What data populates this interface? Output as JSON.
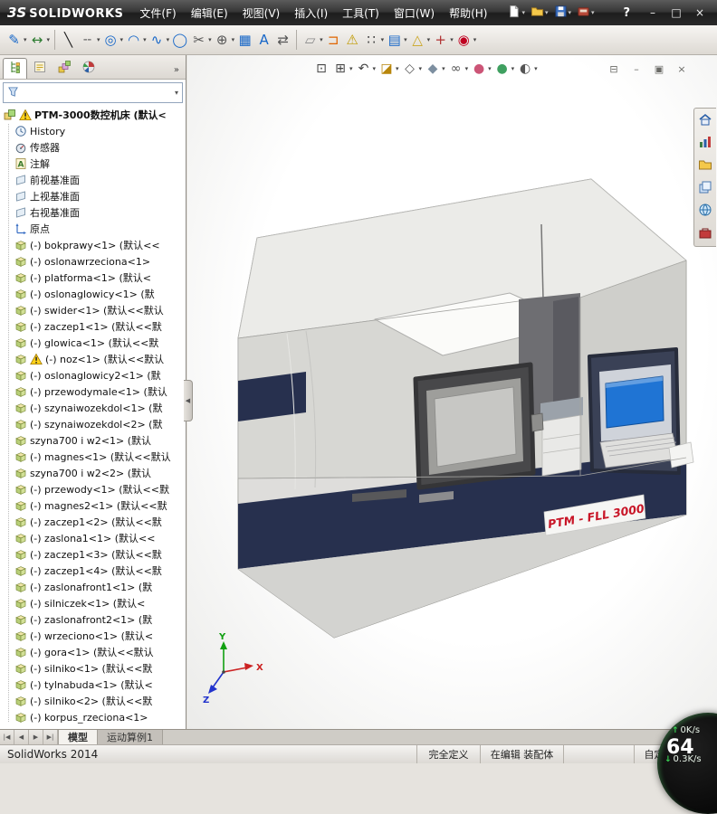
{
  "titlebar": {
    "logo_mark": "3S",
    "logo_text": "SOLIDWORKS",
    "menus": [
      "文件(F)",
      "编辑(E)",
      "视图(V)",
      "插入(I)",
      "工具(T)",
      "窗口(W)",
      "帮助(H)"
    ],
    "quick_icons": [
      "new-doc-icon",
      "open-icon",
      "save-icon",
      "print-icon"
    ],
    "help_button": "?",
    "minimize": "–",
    "maximize": "□",
    "close": "×"
  },
  "sketch_toolbar": {
    "icons": [
      {
        "name": "sketch-icon",
        "caret": true
      },
      {
        "name": "smart-dimension-icon",
        "caret": true
      },
      {
        "name": "sep"
      },
      {
        "name": "line-icon",
        "caret": false
      },
      {
        "name": "centerline-icon",
        "caret": true
      },
      {
        "name": "circle-icon",
        "caret": true
      },
      {
        "name": "arc-icon",
        "caret": true
      },
      {
        "name": "spline-icon",
        "caret": true
      },
      {
        "name": "ellipse-icon",
        "caret": false
      },
      {
        "name": "trim-icon",
        "caret": true
      },
      {
        "name": "point-icon",
        "caret": true
      },
      {
        "name": "hatch-icon",
        "caret": false
      },
      {
        "name": "text-icon",
        "caret": false
      },
      {
        "name": "mirror-icon",
        "caret": false
      },
      {
        "name": "sep"
      },
      {
        "name": "plane-tool-icon",
        "caret": true
      },
      {
        "name": "convert-icon",
        "caret": false
      },
      {
        "name": "relations-icon",
        "caret": false
      },
      {
        "name": "pattern-icon",
        "caret": true
      },
      {
        "name": "grid-icon",
        "caret": true
      },
      {
        "name": "evaluate-icon",
        "caret": true
      },
      {
        "name": "snap-icon",
        "caret": true
      },
      {
        "name": "record-icon",
        "caret": true
      }
    ]
  },
  "panel": {
    "tabs": [
      "featuremanager-tab",
      "propertymanager-tab",
      "configurationmanager-tab",
      "displaymanager-tab"
    ],
    "tabs_overflow": "»",
    "filter": {
      "value": "",
      "placeholder": ""
    },
    "tree": [
      {
        "icon": "assembly-icon",
        "warn": true,
        "top": true,
        "label": "PTM-3000数控机床 (默认<"
      },
      {
        "icon": "history-icon",
        "label": "History"
      },
      {
        "icon": "sensor-icon",
        "label": "传感器"
      },
      {
        "icon": "annotations-icon",
        "label": "注解"
      },
      {
        "icon": "plane-icon",
        "label": "前视基准面"
      },
      {
        "icon": "plane-icon",
        "label": "上视基准面"
      },
      {
        "icon": "plane-icon",
        "label": "右视基准面"
      },
      {
        "icon": "origin-icon",
        "label": "原点"
      },
      {
        "icon": "part-icon",
        "label": "(-) bokprawy<1> (默认<<"
      },
      {
        "icon": "part-icon",
        "label": "(-) oslonawrzeciona<1>"
      },
      {
        "icon": "part-icon",
        "label": "(-) platforma<1> (默认<"
      },
      {
        "icon": "part-icon",
        "label": "(-) oslonaglowicy<1> (默"
      },
      {
        "icon": "part-icon",
        "label": "(-) swider<1> (默认<<默认"
      },
      {
        "icon": "part-icon",
        "label": "(-) zaczep1<1> (默认<<默"
      },
      {
        "icon": "part-icon",
        "label": "(-) glowica<1> (默认<<默"
      },
      {
        "icon": "part-icon",
        "warn": true,
        "label": "(-) noz<1> (默认<<默认"
      },
      {
        "icon": "part-icon",
        "label": "(-) oslonaglowicy2<1> (默"
      },
      {
        "icon": "part-icon",
        "label": "(-) przewodymale<1> (默认"
      },
      {
        "icon": "part-icon",
        "label": "(-) szynaiwozekdol<1> (默"
      },
      {
        "icon": "part-icon",
        "label": "(-) szynaiwozekdol<2> (默"
      },
      {
        "icon": "part-icon",
        "label": "szyna700 i w2<1> (默认"
      },
      {
        "icon": "part-icon",
        "label": "(-) magnes<1> (默认<<默认"
      },
      {
        "icon": "part-icon",
        "label": "szyna700 i w2<2> (默认"
      },
      {
        "icon": "part-icon",
        "label": "(-) przewody<1> (默认<<默"
      },
      {
        "icon": "part-icon",
        "label": "(-) magnes2<1> (默认<<默"
      },
      {
        "icon": "part-icon",
        "label": "(-) zaczep1<2> (默认<<默"
      },
      {
        "icon": "part-icon",
        "label": "(-) zaslona1<1> (默认<<"
      },
      {
        "icon": "part-icon",
        "label": "(-) zaczep1<3> (默认<<默"
      },
      {
        "icon": "part-icon",
        "label": "(-) zaczep1<4> (默认<<默"
      },
      {
        "icon": "part-icon",
        "label": "(-) zaslonafront1<1> (默"
      },
      {
        "icon": "part-icon",
        "label": "(-) silniczek<1> (默认<"
      },
      {
        "icon": "part-icon",
        "label": "(-) zaslonafront2<1> (默"
      },
      {
        "icon": "part-icon",
        "label": "(-) wrzeciono<1> (默认<"
      },
      {
        "icon": "part-icon",
        "label": "(-) gora<1> (默认<<默认"
      },
      {
        "icon": "part-icon",
        "label": "(-) silniko<1> (默认<<默"
      },
      {
        "icon": "part-icon",
        "label": "(-) tylnabuda<1> (默认<"
      },
      {
        "icon": "part-icon",
        "label": "(-) silniko<2> (默认<<默"
      },
      {
        "icon": "part-icon",
        "label": "(-) korpus_rzeciona<1>"
      },
      {
        "icon": "part-icon",
        "label": "(-)"
      }
    ]
  },
  "view_toolbar": {
    "icons": [
      {
        "name": "zoom-fit-icon",
        "caret": false
      },
      {
        "name": "zoom-area-icon",
        "caret": true
      },
      {
        "name": "previous-view-icon",
        "caret": true
      },
      {
        "name": "section-view-icon",
        "caret": true
      },
      {
        "name": "view-orientation-icon",
        "caret": true
      },
      {
        "name": "display-style-icon",
        "caret": true
      },
      {
        "name": "hide-show-icon",
        "caret": true
      },
      {
        "name": "edit-appearance-icon",
        "caret": true
      },
      {
        "name": "apply-scene-icon",
        "caret": true
      },
      {
        "name": "view-settings-icon",
        "caret": true
      }
    ]
  },
  "doc_controls": [
    "split-pane-icon",
    "minimize-doc-icon",
    "restore-doc-icon",
    "close-doc-icon"
  ],
  "right_toolbar": {
    "icons": [
      "home-icon",
      "stats-icon",
      "folder-icon",
      "tasks-icon",
      "web-icon",
      "toolbox-icon"
    ]
  },
  "viewport": {
    "machine_label": "PTM - FLL 3000",
    "triad": {
      "x": "X",
      "y": "Y",
      "z": "Z"
    }
  },
  "doc_tabs": {
    "nav": [
      "first-tab-button",
      "prev-tab-button",
      "next-tab-button",
      "last-tab-button"
    ],
    "tabs": [
      {
        "label": "模型",
        "active": true
      },
      {
        "label": "运动算例1",
        "active": false
      }
    ]
  },
  "statusbar": {
    "app": "SolidWorks 2014",
    "defined": "完全定义",
    "editing": "在编辑 装配体",
    "custom": "自定义"
  },
  "overlay": {
    "value": "64",
    "up_label": "0K/s",
    "down_label": "0.3K/s"
  },
  "colors": {
    "machine_navy": "#27304e",
    "screen_blue": "#1f74d4",
    "label_red": "#c81426",
    "speed_green": "#39d353"
  }
}
